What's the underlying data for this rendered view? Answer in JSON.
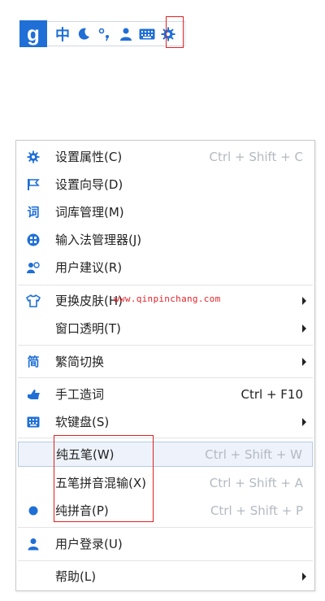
{
  "toolbar": {
    "logo": "g",
    "lang": "中",
    "icons": [
      "logo-icon",
      "lang-cn-icon",
      "moon-icon",
      "punctuation-icon",
      "user-icon",
      "keyboard-icon",
      "gear-icon"
    ]
  },
  "watermark": "www.qinpinchang.com",
  "menu": {
    "items": [
      {
        "label": "设置属性(C)",
        "shortcut": "Ctrl + Shift + C"
      },
      {
        "label": "设置向导(D)"
      },
      {
        "label": "词库管理(M)"
      },
      {
        "label": "输入法管理器(J)"
      },
      {
        "label": "用户建议(R)"
      },
      {
        "label": "更换皮肤(H)"
      },
      {
        "label": "窗口透明(T)"
      },
      {
        "label": "繁简切换"
      },
      {
        "label": "手工造词",
        "shortcut": "Ctrl + F10"
      },
      {
        "label": "软键盘(S)"
      },
      {
        "label": "纯五笔(W)",
        "shortcut": "Ctrl + Shift + W"
      },
      {
        "label": "五笔拼音混输(X)",
        "shortcut": "Ctrl + Shift + A"
      },
      {
        "label": "纯拼音(P)",
        "shortcut": "Ctrl + Shift + P"
      },
      {
        "label": "用户登录(U)"
      },
      {
        "label": "帮助(L)"
      }
    ]
  },
  "colors": {
    "accent": "#1f6fd6",
    "highlight": "#e02020",
    "muted": "#b3b9c2"
  }
}
